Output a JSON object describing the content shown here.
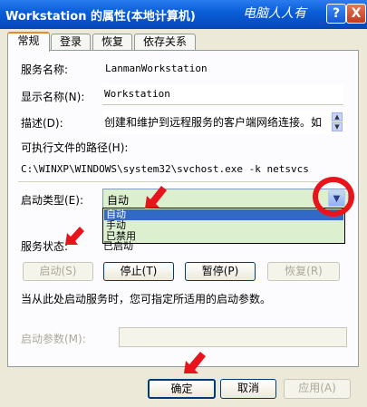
{
  "window": {
    "title": "Workstation 的属性(本地计算机)",
    "watermark": "电脑人人有",
    "help_label": "?",
    "close_label": "X"
  },
  "tabs": [
    {
      "label": "常规",
      "active": true
    },
    {
      "label": "登录",
      "active": false
    },
    {
      "label": "恢复",
      "active": false
    },
    {
      "label": "依存关系",
      "active": false
    }
  ],
  "general": {
    "service_name_label": "服务名称:",
    "service_name_value": "LanmanWorkstation",
    "display_name_label": "显示名称(N):",
    "display_name_value": "Workstation",
    "description_label": "描述(D):",
    "description_value": "创建和维护到远程服务的客户端网络连接。如",
    "exe_path_label": "可执行文件的路径(H):",
    "exe_path_value": "C:\\WINXP\\WINDOWS\\system32\\svchost.exe -k netsvcs",
    "startup_type_label": "启动类型(E):",
    "startup_type_value": "自动",
    "startup_options": [
      "自动",
      "手动",
      "已禁用"
    ],
    "service_status_label": "服务状态:",
    "service_status_value": "已启动",
    "start_button": "启动(S)",
    "stop_button": "停止(T)",
    "pause_button": "暂停(P)",
    "resume_button": "恢复(R)",
    "hint_text": "当从此处启动服务时，您可指定所适用的启动参数。",
    "start_params_label": "启动参数(M):",
    "start_params_value": ""
  },
  "footer": {
    "ok_button": "确定",
    "cancel_button": "取消",
    "apply_button": "应用(A)"
  },
  "colors": {
    "annotation_red": "#e8141c",
    "selection_blue": "#316ac5",
    "combo_green": "#dcf0d0"
  }
}
